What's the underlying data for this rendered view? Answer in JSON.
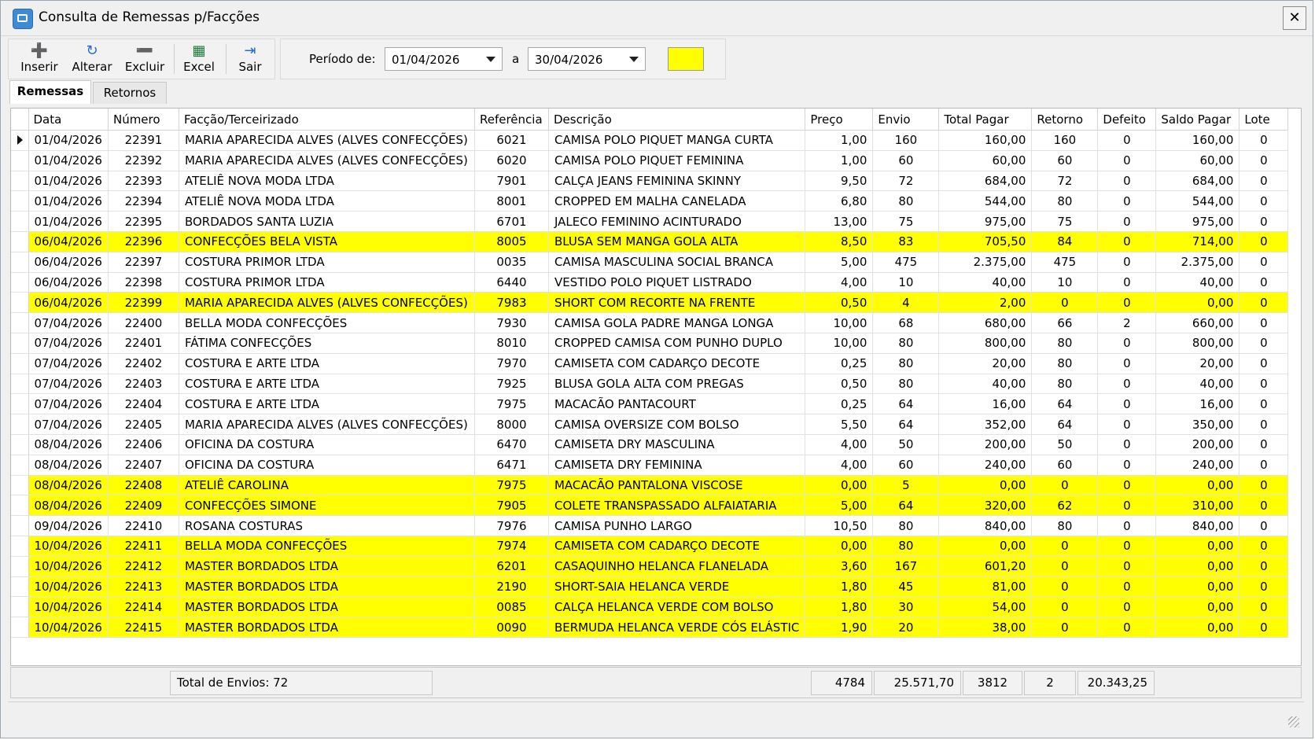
{
  "window": {
    "title": "Consulta de Remessas p/Facções",
    "close_symbol": "✕"
  },
  "toolbar": [
    {
      "label": "Inserir",
      "icon": "plus-icon",
      "glyph": "➕",
      "color": "#2a6ad6"
    },
    {
      "label": "Alterar",
      "icon": "refresh-icon",
      "glyph": "↻",
      "color": "#2a6ad6"
    },
    {
      "label": "Excluir",
      "icon": "minus-icon",
      "glyph": "➖",
      "color": "#2a6ad6"
    },
    {
      "label": "Excel",
      "icon": "excel-icon",
      "glyph": "▦",
      "color": "#1d7a3a"
    },
    {
      "label": "Sair",
      "icon": "exit-door-icon",
      "glyph": "⇥",
      "color": "#2a6ad6"
    }
  ],
  "period": {
    "label": "Período de:",
    "from": "01/04/2026",
    "separator": "a",
    "to": "30/04/2026",
    "highlight_color": "#ffff00"
  },
  "tabs": [
    {
      "label": "Remessas",
      "active": true
    },
    {
      "label": "Retornos",
      "active": false
    }
  ],
  "columns": [
    "Data",
    "Número",
    "Facção/Terceirizado",
    "Referência",
    "Descrição",
    "Preço",
    "Envio",
    "Total Pagar",
    "Retorno",
    "Defeito",
    "Saldo Pagar",
    "Lote"
  ],
  "rows": [
    {
      "cells": [
        "01/04/2026",
        "22391",
        "MARIA APARECIDA ALVES (ALVES CONFECÇÕES)",
        "6021",
        "CAMISA POLO PIQUET MANGA CURTA",
        "1,00",
        "160",
        "160,00",
        "160",
        "0",
        "160,00",
        "0"
      ],
      "highlight": false,
      "current": true
    },
    {
      "cells": [
        "01/04/2026",
        "22392",
        "MARIA APARECIDA ALVES (ALVES CONFECÇÕES)",
        "6020",
        "CAMISA POLO PIQUET FEMININA",
        "1,00",
        "60",
        "60,00",
        "60",
        "0",
        "60,00",
        "0"
      ],
      "highlight": false
    },
    {
      "cells": [
        "01/04/2026",
        "22393",
        "ATELIÊ NOVA MODA LTDA",
        "7901",
        "CALÇA JEANS FEMININA SKINNY",
        "9,50",
        "72",
        "684,00",
        "72",
        "0",
        "684,00",
        "0"
      ],
      "highlight": false
    },
    {
      "cells": [
        "01/04/2026",
        "22394",
        "ATELIÊ NOVA MODA LTDA",
        "8001",
        "CROPPED EM MALHA CANELADA",
        "6,80",
        "80",
        "544,00",
        "80",
        "0",
        "544,00",
        "0"
      ],
      "highlight": false
    },
    {
      "cells": [
        "01/04/2026",
        "22395",
        "BORDADOS SANTA LUZIA",
        "6701",
        "JALECO FEMININO ACINTURADO",
        "13,00",
        "75",
        "975,00",
        "75",
        "0",
        "975,00",
        "0"
      ],
      "highlight": false
    },
    {
      "cells": [
        "06/04/2026",
        "22396",
        "CONFECÇÕES BELA VISTA",
        "8005",
        "BLUSA SEM MANGA GOLA ALTA",
        "8,50",
        "83",
        "705,50",
        "84",
        "0",
        "714,00",
        "0"
      ],
      "highlight": true
    },
    {
      "cells": [
        "06/04/2026",
        "22397",
        "COSTURA PRIMOR LTDA",
        "0035",
        "CAMISA MASCULINA SOCIAL BRANCA",
        "5,00",
        "475",
        "2.375,00",
        "475",
        "0",
        "2.375,00",
        "0"
      ],
      "highlight": false
    },
    {
      "cells": [
        "06/04/2026",
        "22398",
        "COSTURA PRIMOR LTDA",
        "6440",
        "VESTIDO POLO PIQUET LISTRADO",
        "4,00",
        "10",
        "40,00",
        "10",
        "0",
        "40,00",
        "0"
      ],
      "highlight": false
    },
    {
      "cells": [
        "06/04/2026",
        "22399",
        "MARIA APARECIDA ALVES (ALVES CONFECÇÕES)",
        "7983",
        "SHORT COM RECORTE NA FRENTE",
        "0,50",
        "4",
        "2,00",
        "0",
        "0",
        "0,00",
        "0"
      ],
      "highlight": true
    },
    {
      "cells": [
        "07/04/2026",
        "22400",
        "BELLA MODA CONFECÇÕES",
        "7930",
        "CAMISA GOLA PADRE MANGA LONGA",
        "10,00",
        "68",
        "680,00",
        "66",
        "2",
        "660,00",
        "0"
      ],
      "highlight": false
    },
    {
      "cells": [
        "07/04/2026",
        "22401",
        "FÁTIMA CONFECÇÕES",
        "8010",
        "CROPPED CAMISA COM PUNHO DUPLO",
        "10,00",
        "80",
        "800,00",
        "80",
        "0",
        "800,00",
        "0"
      ],
      "highlight": false
    },
    {
      "cells": [
        "07/04/2026",
        "22402",
        "COSTURA E ARTE LTDA",
        "7970",
        "CAMISETA COM CADARÇO DECOTE",
        "0,25",
        "80",
        "20,00",
        "80",
        "0",
        "20,00",
        "0"
      ],
      "highlight": false
    },
    {
      "cells": [
        "07/04/2026",
        "22403",
        "COSTURA E ARTE LTDA",
        "7925",
        "BLUSA GOLA ALTA COM PREGAS",
        "0,50",
        "80",
        "40,00",
        "80",
        "0",
        "40,00",
        "0"
      ],
      "highlight": false
    },
    {
      "cells": [
        "07/04/2026",
        "22404",
        "COSTURA E ARTE LTDA",
        "7975",
        "MACACÃO PANTACOURT",
        "0,25",
        "64",
        "16,00",
        "64",
        "0",
        "16,00",
        "0"
      ],
      "highlight": false
    },
    {
      "cells": [
        "07/04/2026",
        "22405",
        "MARIA APARECIDA ALVES (ALVES CONFECÇÕES)",
        "8000",
        "CAMISA OVERSIZE COM BOLSO",
        "5,50",
        "64",
        "352,00",
        "64",
        "0",
        "350,00",
        "0"
      ],
      "highlight": false
    },
    {
      "cells": [
        "08/04/2026",
        "22406",
        "OFICINA DA COSTURA",
        "6470",
        "CAMISETA DRY MASCULINA",
        "4,00",
        "50",
        "200,00",
        "50",
        "0",
        "200,00",
        "0"
      ],
      "highlight": false
    },
    {
      "cells": [
        "08/04/2026",
        "22407",
        "OFICINA DA COSTURA",
        "6471",
        "CAMISETA DRY FEMININA",
        "4,00",
        "60",
        "240,00",
        "60",
        "0",
        "240,00",
        "0"
      ],
      "highlight": false
    },
    {
      "cells": [
        "08/04/2026",
        "22408",
        "ATELIÊ CAROLINA",
        "7975",
        "MACACÃO PANTALONA VISCOSE",
        "0,00",
        "5",
        "0,00",
        "0",
        "0",
        "0,00",
        "0"
      ],
      "highlight": true
    },
    {
      "cells": [
        "08/04/2026",
        "22409",
        "CONFECÇÕES SIMONE",
        "7905",
        "COLETE TRANSPASSADO ALFAIATARIA",
        "5,00",
        "64",
        "320,00",
        "62",
        "0",
        "310,00",
        "0"
      ],
      "highlight": true
    },
    {
      "cells": [
        "09/04/2026",
        "22410",
        "ROSANA COSTURAS",
        "7976",
        "CAMISA PUNHO LARGO",
        "10,50",
        "80",
        "840,00",
        "80",
        "0",
        "840,00",
        "0"
      ],
      "highlight": false
    },
    {
      "cells": [
        "10/04/2026",
        "22411",
        "BELLA MODA CONFECÇÕES",
        "7974",
        "CAMISETA COM CADARÇO DECOTE",
        "0,00",
        "80",
        "0,00",
        "0",
        "0",
        "0,00",
        "0"
      ],
      "highlight": true
    },
    {
      "cells": [
        "10/04/2026",
        "22412",
        "MASTER BORDADOS LTDA",
        "6201",
        "CASAQUINHO HELANCA FLANELADA",
        "3,60",
        "167",
        "601,20",
        "0",
        "0",
        "0,00",
        "0"
      ],
      "highlight": true
    },
    {
      "cells": [
        "10/04/2026",
        "22413",
        "MASTER BORDADOS LTDA",
        "2190",
        "SHORT-SAIA HELANCA VERDE",
        "1,80",
        "45",
        "81,00",
        "0",
        "0",
        "0,00",
        "0"
      ],
      "highlight": true
    },
    {
      "cells": [
        "10/04/2026",
        "22414",
        "MASTER BORDADOS LTDA",
        "0085",
        "CALÇA HELANCA VERDE COM BOLSO",
        "1,80",
        "30",
        "54,00",
        "0",
        "0",
        "0,00",
        "0"
      ],
      "highlight": true
    },
    {
      "cells": [
        "10/04/2026",
        "22415",
        "MASTER BORDADOS LTDA",
        "0090",
        "BERMUDA HELANCA VERDE CÓS ELÁSTIC",
        "1,90",
        "20",
        "38,00",
        "0",
        "0",
        "0,00",
        "0"
      ],
      "highlight": true
    }
  ],
  "footer": {
    "total_envios": "Total de Envios: 72",
    "envio": "4784",
    "total_pagar": "25.571,70",
    "retorno": "3812",
    "defeito": "2",
    "saldo_pagar": "20.343,25"
  }
}
